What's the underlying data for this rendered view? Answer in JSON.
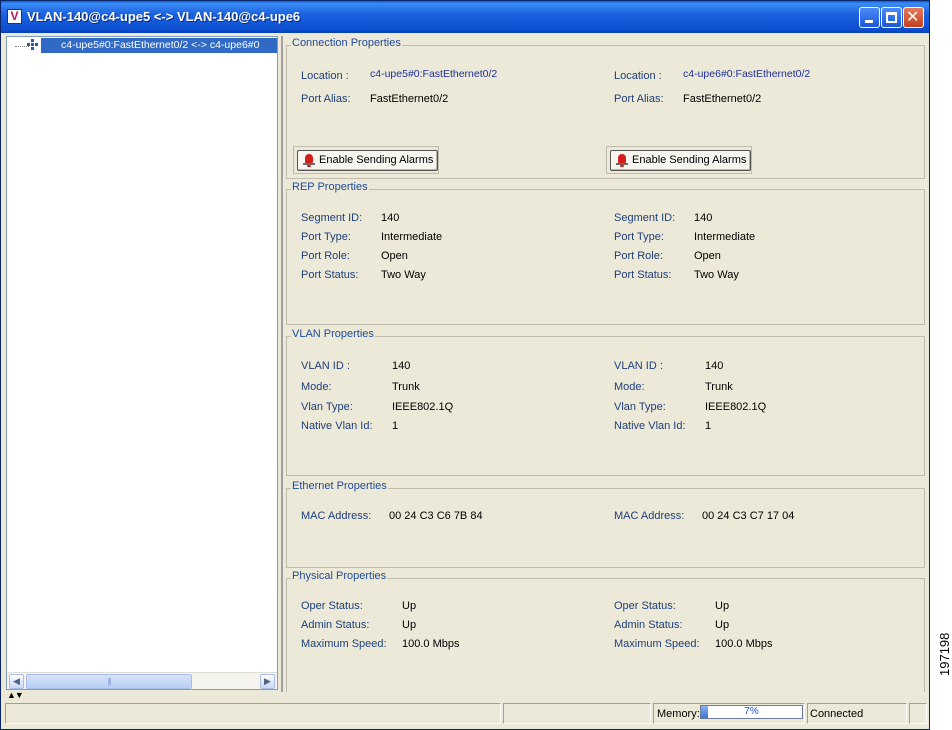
{
  "window": {
    "title": "VLAN-140@c4-upe5 <-> VLAN-140@c4-upe6",
    "app_icon_letter": "V"
  },
  "tree": {
    "item_label": "c4-upe5#0:FastEthernet0/2 <-> c4-upe6#0"
  },
  "connection": {
    "title": "Connection Properties",
    "left": {
      "location_label": "Location :",
      "location": "c4-upe5#0:FastEthernet0/2",
      "alias_label": "Port Alias:",
      "alias": "FastEthernet0/2",
      "button": "Enable Sending Alarms"
    },
    "right": {
      "location_label": "Location :",
      "location": "c4-upe6#0:FastEthernet0/2",
      "alias_label": "Port Alias:",
      "alias": "FastEthernet0/2",
      "button": "Enable Sending Alarms"
    }
  },
  "rep": {
    "title": "REP Properties",
    "labels": [
      "Segment ID:",
      "Port Type:",
      "Port Role:",
      "Port Status:"
    ],
    "left": [
      "140",
      "Intermediate",
      "Open",
      "Two Way"
    ],
    "right": [
      "140",
      "Intermediate",
      "Open",
      "Two Way"
    ]
  },
  "vlan": {
    "title": "VLAN Properties",
    "labels": [
      "VLAN ID :",
      "Mode:",
      "Vlan Type:",
      "Native Vlan Id:"
    ],
    "left": [
      "140",
      "Trunk",
      "IEEE802.1Q",
      "1"
    ],
    "right": [
      "140",
      "Trunk",
      "IEEE802.1Q",
      "1"
    ]
  },
  "ethernet": {
    "title": "Ethernet Properties",
    "label": "MAC Address:",
    "left": "00 24 C3 C6 7B 84",
    "right": "00 24 C3 C7 17 04"
  },
  "physical": {
    "title": "Physical Properties",
    "labels": [
      "Oper Status:",
      "Admin Status:",
      "Maximum Speed:"
    ],
    "left": [
      "Up",
      "Up",
      "100.0 Mbps"
    ],
    "right": [
      "Up",
      "Up",
      "100.0 Mbps"
    ]
  },
  "status": {
    "memory_label": "Memory:",
    "memory_percent": 7,
    "memory_text": "7%",
    "connection": "Connected"
  },
  "side_code": "197198",
  "colors": {
    "title_bar": "#0b4fd1",
    "selection": "#316ac5",
    "group_title": "#1f4a9a"
  }
}
